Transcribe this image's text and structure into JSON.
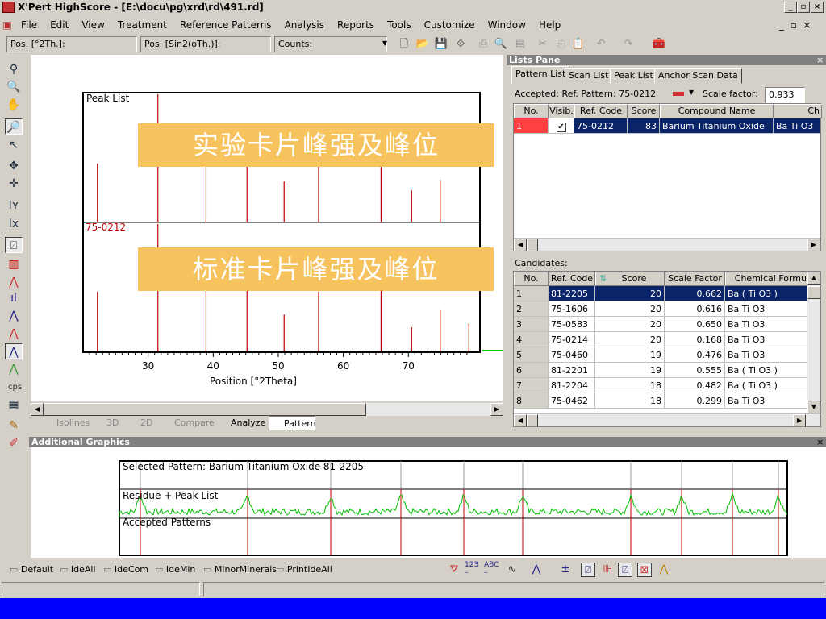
{
  "window": {
    "title": "X'Pert HighScore - [E:\\docu\\pg\\xrd\\rd\\491.rd]"
  },
  "menu": [
    "File",
    "Edit",
    "View",
    "Treatment",
    "Reference Patterns",
    "Analysis",
    "Reports",
    "Tools",
    "Customize",
    "Window",
    "Help"
  ],
  "toolbar": {
    "combo1": "Pos. [°2Th.]:",
    "combo2": "Pos. [Sin2(oTh.)]:",
    "combo3": "Counts:"
  },
  "plot": {
    "top_label": "Peak List",
    "bottom_label": "75-0212",
    "banner_top": "实验卡片峰强及峰位",
    "banner_bottom": "标准卡片峰强及峰位",
    "xlabel": "Position [°2Theta]",
    "ticks": [
      "30",
      "40",
      "50",
      "60",
      "70"
    ],
    "colors": {
      "peak": "#c00000",
      "ref": "#c00000"
    }
  },
  "chart_data": {
    "type": "bar",
    "xlabel": "Position [°2Theta]",
    "xlim": [
      20,
      81
    ],
    "x_ticks": [
      30,
      40,
      50,
      60,
      70
    ],
    "series": [
      {
        "name": "Peak List",
        "x": [
          22.2,
          31.5,
          38.9,
          45.2,
          50.9,
          56.2,
          65.8,
          70.5,
          74.9
        ],
        "values": [
          0.46,
          1.0,
          0.43,
          0.44,
          0.32,
          0.44,
          0.44,
          0.25,
          0.33
        ]
      },
      {
        "name": "75-0212",
        "x": [
          22.2,
          31.5,
          38.9,
          45.2,
          50.9,
          56.2,
          65.8,
          70.5,
          74.9,
          79.3
        ],
        "values": [
          0.47,
          1.0,
          0.48,
          0.5,
          0.29,
          0.47,
          0.49,
          0.19,
          0.33,
          0.22
        ]
      }
    ]
  },
  "plot_tabs": [
    "Isolines",
    "3D",
    "2D",
    "Compare",
    "Analyze",
    "Pattern"
  ],
  "lists_pane": {
    "title": "Lists Pane",
    "tabs": [
      "Pattern List",
      "Scan List",
      "Peak List",
      "Anchor Scan Data"
    ],
    "accepted": "Accepted: Ref. Pattern: 75-0212",
    "scale_label": "Scale factor:",
    "scale_value": "0.933",
    "pattern_headers": [
      "No.",
      "Visib.",
      "Ref. Code",
      "Score",
      "Compound Name",
      "Ch"
    ],
    "pattern_row": {
      "no": "1",
      "ref": "75-0212",
      "score": "83",
      "name": "Barium Titanium Oxide",
      "ch": "Ba Ti O3"
    },
    "candidates_label": "Candidates:",
    "cand_headers": [
      "No.",
      "Ref. Code",
      "Score",
      "Scale Factor",
      "Chemical Formu"
    ],
    "candidates": [
      {
        "no": "1",
        "ref": "81-2205",
        "score": "20",
        "scale": "0.662",
        "formula": "Ba ( Ti O3 )"
      },
      {
        "no": "2",
        "ref": "75-1606",
        "score": "20",
        "scale": "0.616",
        "formula": "Ba Ti O3"
      },
      {
        "no": "3",
        "ref": "75-0583",
        "score": "20",
        "scale": "0.650",
        "formula": "Ba Ti O3"
      },
      {
        "no": "4",
        "ref": "75-0214",
        "score": "20",
        "scale": "0.168",
        "formula": "Ba Ti O3"
      },
      {
        "no": "5",
        "ref": "75-0460",
        "score": "19",
        "scale": "0.476",
        "formula": "Ba Ti O3"
      },
      {
        "no": "6",
        "ref": "81-2201",
        "score": "19",
        "scale": "0.555",
        "formula": "Ba ( Ti O3 )"
      },
      {
        "no": "7",
        "ref": "81-2204",
        "score": "18",
        "scale": "0.482",
        "formula": "Ba ( Ti O3 )"
      },
      {
        "no": "8",
        "ref": "75-0462",
        "score": "18",
        "scale": "0.299",
        "formula": "Ba Ti O3"
      }
    ]
  },
  "additional": {
    "title": "Additional Graphics",
    "selected": "Selected Pattern: Barium Titanium Oxide  81-2205",
    "residue": "Residue + Peak List",
    "accepted": "Accepted Patterns"
  },
  "bottom_toolbar": [
    "Default",
    "IdeAll",
    "IdeCom",
    "IdeMin",
    "MinorMinerals",
    "PrintIdeAll"
  ],
  "left_tools": [
    "zoom-in-icon",
    "zoom-out-icon",
    "hand-icon",
    "magnifier-icon",
    "pointer-icon",
    "move-icon",
    "crosshair-icon",
    "y-axis-icon",
    "x-axis-icon",
    "fit-icon",
    "bars-icon",
    "peaks-icon",
    "histogram-icon",
    "lines-icon",
    "profile-icon",
    "profile2-icon",
    "spectrum-icon",
    "cps-label",
    "grid-icon",
    "pen-icon",
    "eraser-icon"
  ],
  "cps": "cps"
}
